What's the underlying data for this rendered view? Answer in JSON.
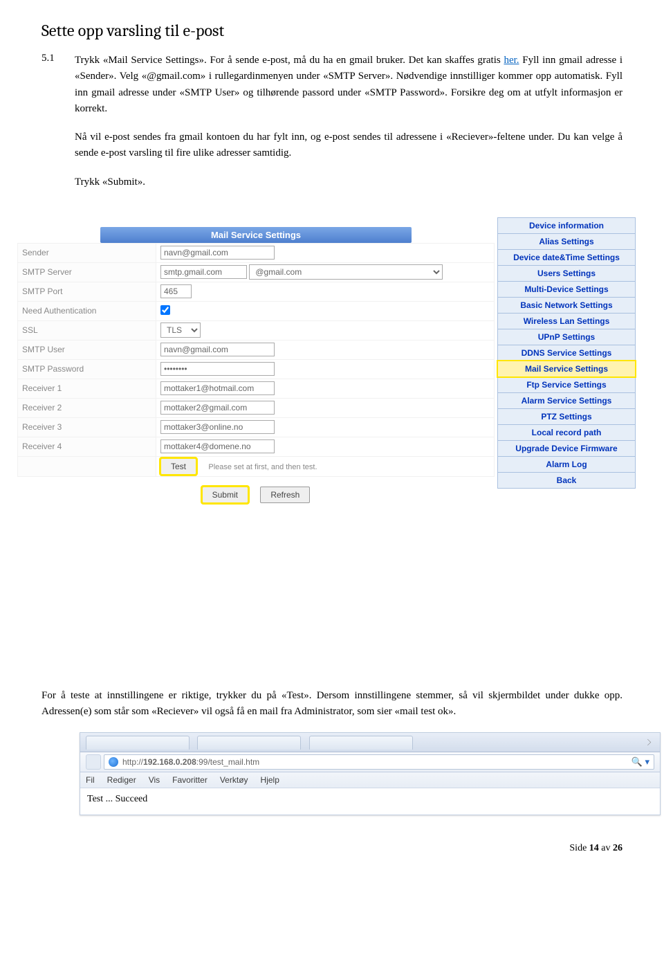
{
  "heading": "Sette opp varsling til e-post",
  "section_num": "5.1",
  "para1_pre": "Trykk «Mail Service Settings». For å sende e-post, må du ha en gmail bruker. Det kan skaffes gratis ",
  "para1_link": "her.",
  "para1_post": " Fyll inn gmail adresse i «Sender». Velg «@gmail.com» i rullegardinmenyen under «SMTP Server». Nødvendige innstilliger kommer opp automatisk. Fyll inn gmail adresse under «SMTP User» og tilhørende passord under «SMTP Password». Forsikre deg om at utfylt informasjon er korrekt.",
  "para2": "Nå vil e-post sendes fra gmail kontoen du har fylt inn, og e-post sendes til adressene i «Reciever»-feltene under. Du kan velge å sende e-post varsling til fire ulike adresser samtidig.",
  "para3": "Trykk «Submit».",
  "form": {
    "title": "Mail Service Settings",
    "rows": {
      "sender_label": "Sender",
      "sender_value": "navn@gmail.com",
      "smtpserver_label": "SMTP Server",
      "smtpserver_value": "smtp.gmail.com",
      "smtp_domain": "@gmail.com",
      "smtpport_label": "SMTP Port",
      "smtpport_value": "465",
      "needauth_label": "Need Authentication",
      "ssl_label": "SSL",
      "ssl_value": "TLS",
      "smtpuser_label": "SMTP User",
      "smtpuser_value": "navn@gmail.com",
      "smtppass_label": "SMTP Password",
      "smtppass_value": "••••••••",
      "recv1_label": "Receiver 1",
      "recv1_value": "mottaker1@hotmail.com",
      "recv2_label": "Receiver 2",
      "recv2_value": "mottaker2@gmail.com",
      "recv3_label": "Receiver 3",
      "recv3_value": "mottaker3@online.no",
      "recv4_label": "Receiver 4",
      "recv4_value": "mottaker4@domene.no"
    },
    "test_btn": "Test",
    "test_hint": "Please set at first, and then test.",
    "submit_btn": "Submit",
    "refresh_btn": "Refresh"
  },
  "sidebar": [
    "Device information",
    "Alias Settings",
    "Device date&Time Settings",
    "Users Settings",
    "Multi-Device Settings",
    "Basic Network Settings",
    "Wireless Lan Settings",
    "UPnP Settings",
    "DDNS Service Settings",
    "Mail Service Settings",
    "Ftp Service Settings",
    "Alarm Service Settings",
    "PTZ Settings",
    "Local record path",
    "Upgrade Device Firmware",
    "Alarm Log",
    "Back"
  ],
  "sidebar_active_index": 9,
  "para4": "For å teste at innstillingene er riktige, trykker du på «Test». Dersom innstillingene stemmer, så vil skjermbildet under dukke opp. Adressen(e) som står som «Reciever» vil også få en mail fra Administrator, som sier «mail test ok».",
  "browser": {
    "url_pre": "http://",
    "url_mid": "192.168.0.208",
    "url_post": ":99/test_mail.htm",
    "menu": [
      "Fil",
      "Rediger",
      "Vis",
      "Favoritter",
      "Verktøy",
      "Hjelp"
    ],
    "result": "Test ... Succeed"
  },
  "page_footer_pre": "Side ",
  "page_footer_cur": "14",
  "page_footer_mid": " av ",
  "page_footer_total": "26"
}
